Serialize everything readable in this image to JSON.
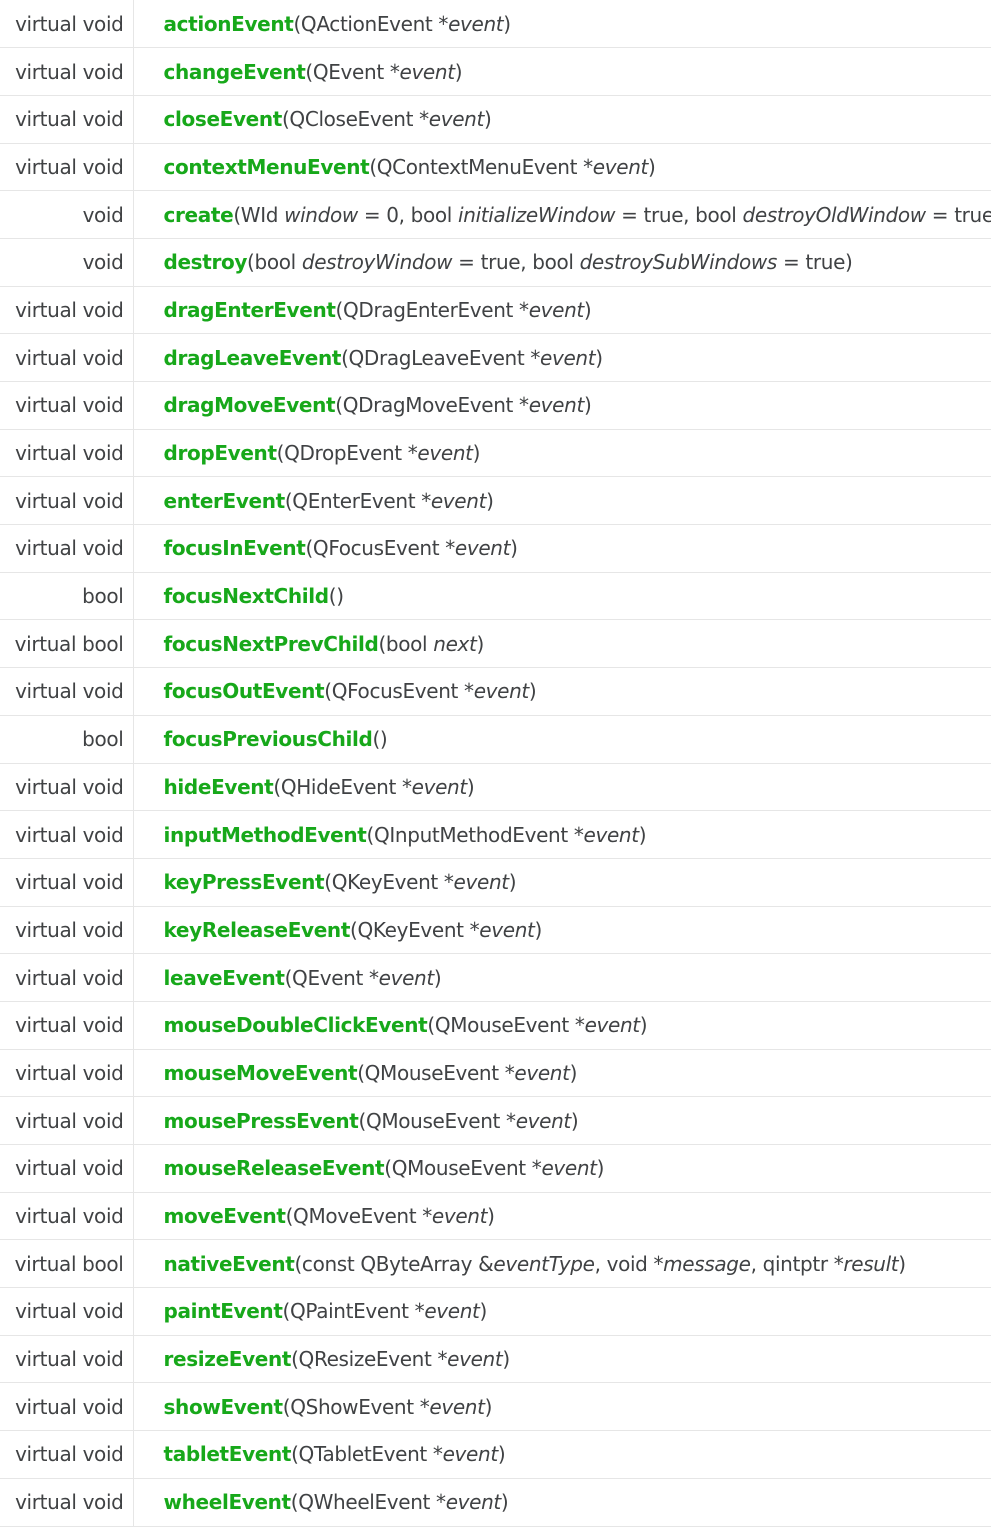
{
  "rows": [
    {
      "ret": "virtual void",
      "name": "actionEvent",
      "parts": [
        {
          "t": "(QActionEvent *"
        },
        {
          "t": "event",
          "i": true
        },
        {
          "t": ")"
        }
      ]
    },
    {
      "ret": "virtual void",
      "name": "changeEvent",
      "parts": [
        {
          "t": "(QEvent *"
        },
        {
          "t": "event",
          "i": true
        },
        {
          "t": ")"
        }
      ]
    },
    {
      "ret": "virtual void",
      "name": "closeEvent",
      "parts": [
        {
          "t": "(QCloseEvent *"
        },
        {
          "t": "event",
          "i": true
        },
        {
          "t": ")"
        }
      ]
    },
    {
      "ret": "virtual void",
      "name": "contextMenuEvent",
      "parts": [
        {
          "t": "(QContextMenuEvent *"
        },
        {
          "t": "event",
          "i": true
        },
        {
          "t": ")"
        }
      ]
    },
    {
      "ret": "void",
      "name": "create",
      "parts": [
        {
          "t": "(WId "
        },
        {
          "t": "window",
          "i": true
        },
        {
          "t": " = 0, bool "
        },
        {
          "t": "initializeWindow",
          "i": true
        },
        {
          "t": " = true, bool "
        },
        {
          "t": "destroyOldWindow",
          "i": true
        },
        {
          "t": " = true)"
        }
      ]
    },
    {
      "ret": "void",
      "name": "destroy",
      "parts": [
        {
          "t": "(bool "
        },
        {
          "t": "destroyWindow",
          "i": true
        },
        {
          "t": " = true, bool "
        },
        {
          "t": "destroySubWindows",
          "i": true
        },
        {
          "t": " = true)"
        }
      ]
    },
    {
      "ret": "virtual void",
      "name": "dragEnterEvent",
      "parts": [
        {
          "t": "(QDragEnterEvent *"
        },
        {
          "t": "event",
          "i": true
        },
        {
          "t": ")"
        }
      ]
    },
    {
      "ret": "virtual void",
      "name": "dragLeaveEvent",
      "parts": [
        {
          "t": "(QDragLeaveEvent *"
        },
        {
          "t": "event",
          "i": true
        },
        {
          "t": ")"
        }
      ]
    },
    {
      "ret": "virtual void",
      "name": "dragMoveEvent",
      "parts": [
        {
          "t": "(QDragMoveEvent *"
        },
        {
          "t": "event",
          "i": true
        },
        {
          "t": ")"
        }
      ]
    },
    {
      "ret": "virtual void",
      "name": "dropEvent",
      "parts": [
        {
          "t": "(QDropEvent *"
        },
        {
          "t": "event",
          "i": true
        },
        {
          "t": ")"
        }
      ]
    },
    {
      "ret": "virtual void",
      "name": "enterEvent",
      "parts": [
        {
          "t": "(QEnterEvent *"
        },
        {
          "t": "event",
          "i": true
        },
        {
          "t": ")"
        }
      ]
    },
    {
      "ret": "virtual void",
      "name": "focusInEvent",
      "parts": [
        {
          "t": "(QFocusEvent *"
        },
        {
          "t": "event",
          "i": true
        },
        {
          "t": ")"
        }
      ]
    },
    {
      "ret": "bool",
      "name": "focusNextChild",
      "parts": [
        {
          "t": "()"
        }
      ]
    },
    {
      "ret": "virtual bool",
      "name": "focusNextPrevChild",
      "parts": [
        {
          "t": "(bool "
        },
        {
          "t": "next",
          "i": true
        },
        {
          "t": ")"
        }
      ]
    },
    {
      "ret": "virtual void",
      "name": "focusOutEvent",
      "parts": [
        {
          "t": "(QFocusEvent *"
        },
        {
          "t": "event",
          "i": true
        },
        {
          "t": ")"
        }
      ]
    },
    {
      "ret": "bool",
      "name": "focusPreviousChild",
      "parts": [
        {
          "t": "()"
        }
      ]
    },
    {
      "ret": "virtual void",
      "name": "hideEvent",
      "parts": [
        {
          "t": "(QHideEvent *"
        },
        {
          "t": "event",
          "i": true
        },
        {
          "t": ")"
        }
      ]
    },
    {
      "ret": "virtual void",
      "name": "inputMethodEvent",
      "parts": [
        {
          "t": "(QInputMethodEvent *"
        },
        {
          "t": "event",
          "i": true
        },
        {
          "t": ")"
        }
      ]
    },
    {
      "ret": "virtual void",
      "name": "keyPressEvent",
      "parts": [
        {
          "t": "(QKeyEvent *"
        },
        {
          "t": "event",
          "i": true
        },
        {
          "t": ")"
        }
      ]
    },
    {
      "ret": "virtual void",
      "name": "keyReleaseEvent",
      "parts": [
        {
          "t": "(QKeyEvent *"
        },
        {
          "t": "event",
          "i": true
        },
        {
          "t": ")"
        }
      ]
    },
    {
      "ret": "virtual void",
      "name": "leaveEvent",
      "parts": [
        {
          "t": "(QEvent *"
        },
        {
          "t": "event",
          "i": true
        },
        {
          "t": ")"
        }
      ]
    },
    {
      "ret": "virtual void",
      "name": "mouseDoubleClickEvent",
      "parts": [
        {
          "t": "(QMouseEvent *"
        },
        {
          "t": "event",
          "i": true
        },
        {
          "t": ")"
        }
      ]
    },
    {
      "ret": "virtual void",
      "name": "mouseMoveEvent",
      "parts": [
        {
          "t": "(QMouseEvent *"
        },
        {
          "t": "event",
          "i": true
        },
        {
          "t": ")"
        }
      ]
    },
    {
      "ret": "virtual void",
      "name": "mousePressEvent",
      "parts": [
        {
          "t": "(QMouseEvent *"
        },
        {
          "t": "event",
          "i": true
        },
        {
          "t": ")"
        }
      ]
    },
    {
      "ret": "virtual void",
      "name": "mouseReleaseEvent",
      "parts": [
        {
          "t": "(QMouseEvent *"
        },
        {
          "t": "event",
          "i": true
        },
        {
          "t": ")"
        }
      ]
    },
    {
      "ret": "virtual void",
      "name": "moveEvent",
      "parts": [
        {
          "t": "(QMoveEvent *"
        },
        {
          "t": "event",
          "i": true
        },
        {
          "t": ")"
        }
      ]
    },
    {
      "ret": "virtual bool",
      "name": "nativeEvent",
      "parts": [
        {
          "t": "(const QByteArray &"
        },
        {
          "t": "eventType",
          "i": true
        },
        {
          "t": ", void *"
        },
        {
          "t": "message",
          "i": true
        },
        {
          "t": ", qintptr *"
        },
        {
          "t": "result",
          "i": true
        },
        {
          "t": ")"
        }
      ]
    },
    {
      "ret": "virtual void",
      "name": "paintEvent",
      "parts": [
        {
          "t": "(QPaintEvent *"
        },
        {
          "t": "event",
          "i": true
        },
        {
          "t": ")"
        }
      ]
    },
    {
      "ret": "virtual void",
      "name": "resizeEvent",
      "parts": [
        {
          "t": "(QResizeEvent *"
        },
        {
          "t": "event",
          "i": true
        },
        {
          "t": ")"
        }
      ]
    },
    {
      "ret": "virtual void",
      "name": "showEvent",
      "parts": [
        {
          "t": "(QShowEvent *"
        },
        {
          "t": "event",
          "i": true
        },
        {
          "t": ")"
        }
      ]
    },
    {
      "ret": "virtual void",
      "name": "tabletEvent",
      "parts": [
        {
          "t": "(QTabletEvent *"
        },
        {
          "t": "event",
          "i": true
        },
        {
          "t": ")"
        }
      ]
    },
    {
      "ret": "virtual void",
      "name": "wheelEvent",
      "parts": [
        {
          "t": "(QWheelEvent *"
        },
        {
          "t": "event",
          "i": true
        },
        {
          "t": ")"
        }
      ]
    }
  ],
  "colors": {
    "link": "#17a81a",
    "text": "#404244",
    "border": "#e6e6e6"
  }
}
